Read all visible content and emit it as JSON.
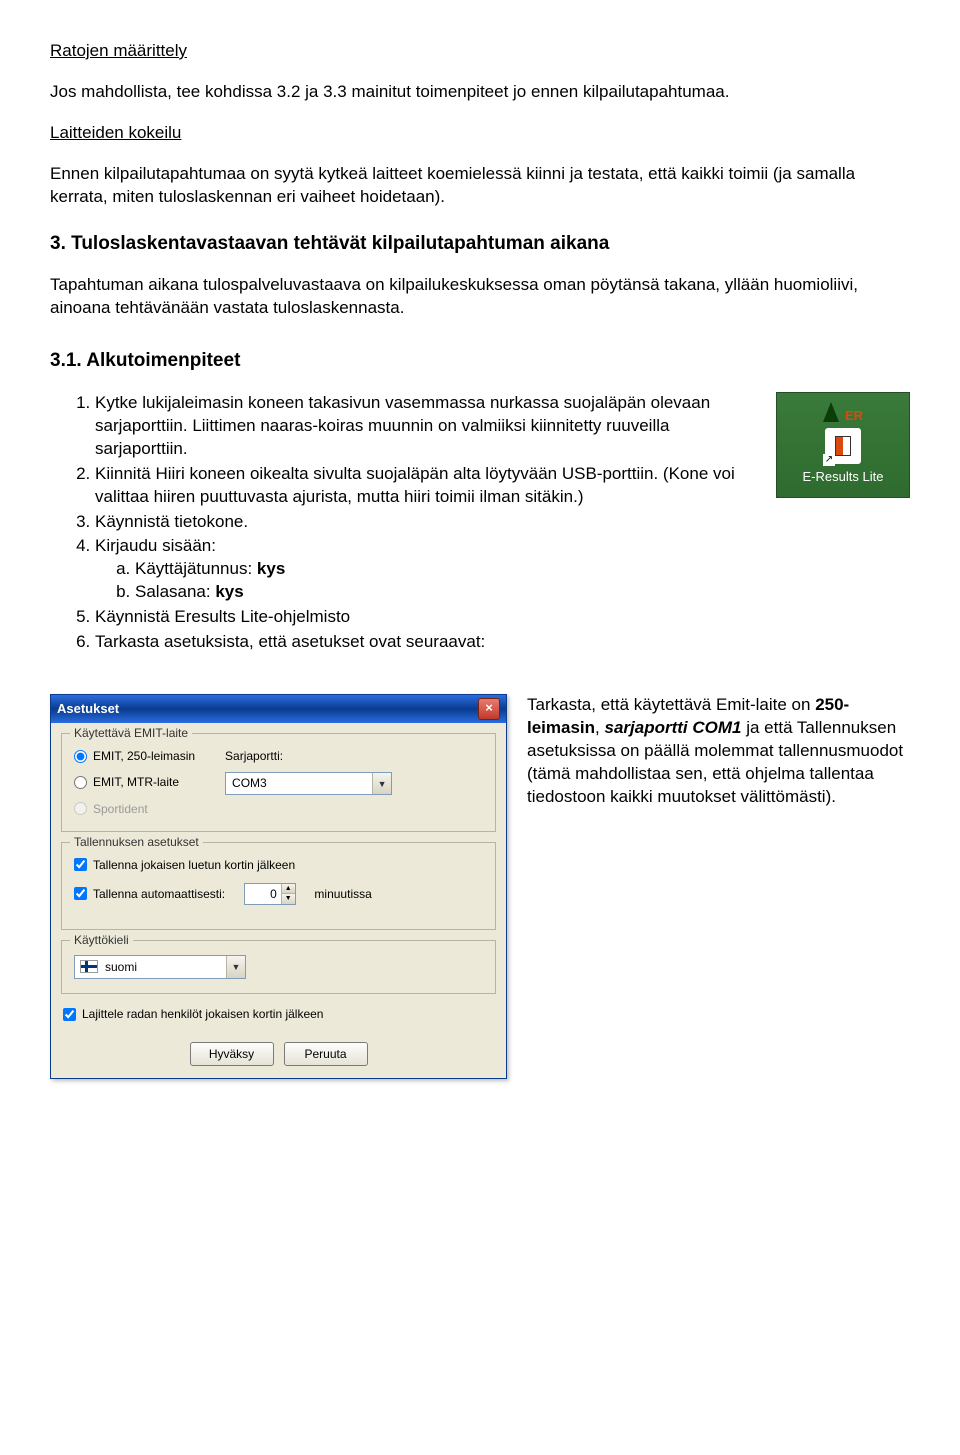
{
  "headings": {
    "ratojen": "Ratojen määrittely",
    "laitteiden": "Laitteiden kokeilu",
    "section3": "3. Tuloslaskentavastaavan tehtävät kilpailutapahtuman aikana",
    "sub31": "3.1. Alkutoimenpiteet"
  },
  "paragraphs": {
    "ratojen_p": "Jos mahdollista, tee kohdissa 3.2 ja 3.3 mainitut toimenpiteet jo ennen kilpailutapahtumaa.",
    "laitteiden_p": "Ennen kilpailutapahtumaa on syytä kytkeä laitteet koemielessä kiinni ja testata, että kaikki toimii (ja samalla kerrata, miten tuloslaskennan eri vaiheet hoidetaan).",
    "section3_p": "Tapahtuman aikana tulospalveluvastaava on kilpailukeskuksessa oman pöytänsä takana, yllään huomioliivi, ainoana tehtävänään vastata tuloslaskennasta."
  },
  "steps": {
    "s1": "Kytke lukijaleimasin koneen takasivun vasemmassa nurkassa suojaläpän olevaan sarjaporttiin. Liittimen naaras-koiras muunnin on valmiiksi kiinnitetty ruuveilla sarjaporttiin.",
    "s2": "Kiinnitä Hiiri koneen oikealta sivulta suojaläpän alta löytyvään USB-porttiin. (Kone voi valittaa hiiren puuttuvasta ajurista, mutta hiiri toimii ilman sitäkin.)",
    "s3": "Käynnistä tietokone.",
    "s4": "Kirjaudu sisään:",
    "s4a_label": "Käyttäjätunnus: ",
    "s4a_val": "kys",
    "s4b_label": "Salasana: ",
    "s4b_val": "kys",
    "s5": "Käynnistä Eresults Lite-ohjelmisto",
    "s6": "Tarkasta asetuksista, että asetukset ovat seuraavat:"
  },
  "desktop_icon": {
    "er": "ER",
    "label": "E-Results Lite"
  },
  "dialog": {
    "title": "Asetukset",
    "close": "×",
    "group_emit": "Käytettävä EMIT-laite",
    "r1": "EMIT, 250-leimasin",
    "r2": "EMIT, MTR-laite",
    "r3": "Sportident",
    "port_label": "Sarjaportti:",
    "port_val": "COM3",
    "group_save": "Tallennuksen asetukset",
    "chk1": "Tallenna jokaisen luetun kortin jälkeen",
    "chk2_label": "Tallenna automaattisesti:",
    "chk2_val": "0",
    "chk2_unit": "minuutissa",
    "group_lang": "Käyttökieli",
    "lang_val": "suomi",
    "chk3": "Lajittele radan henkilöt jokaisen kortin jälkeen",
    "btn_ok": "Hyväksy",
    "btn_cancel": "Peruuta"
  },
  "side_note": {
    "t1": "Tarkasta, että käytettävä Emit-laite on ",
    "t2": "250-leimasin",
    "t3": ", ",
    "t4": "sarjaportti COM1",
    "t5": " ja että Tallennuksen asetuksissa on päällä molemmat tallennusmuodot (tämä mahdollistaa sen, että ohjelma tallentaa tiedostoon kaikki muutokset välittömästi)."
  }
}
